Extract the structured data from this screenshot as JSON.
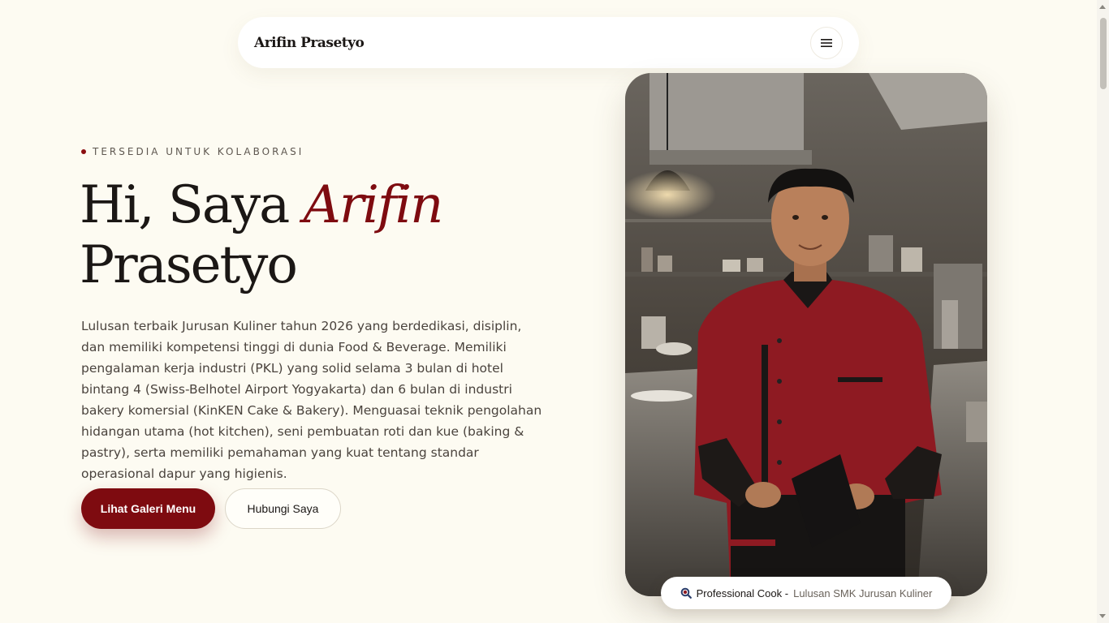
{
  "navbar": {
    "brand": "Arifin Prasetyo",
    "menu_icon": "hamburger-menu-icon"
  },
  "hero": {
    "eyebrow": "TERSEDIA UNTUK KOLABORASI",
    "headline_prefix": "Hi, Saya",
    "headline_accent": "Arifin",
    "headline_last": "Prasetyo",
    "description": "Lulusan terbaik Jurusan Kuliner tahun 2026 yang berdedikasi, disiplin, dan memiliki kompetensi tinggi di dunia Food & Beverage. Memiliki pengalaman kerja industri (PKL) yang solid selama 3 bulan di hotel bintang 4 (Swiss-Belhotel Airport Yogyakarta) dan 6 bulan di industri bakery komersial (KinKEN Cake & Bakery). Menguasai teknik pengolahan hidangan utama (hot kitchen), seni pembuatan roti dan kue (baking & pastry), serta memiliki pemahaman yang kuat tentang standar operasional dapur yang higienis.",
    "primary_button": "Lihat Galeri Menu",
    "secondary_button": "Hubungi Saya"
  },
  "photo": {
    "badge_title": "Professional Cook -",
    "badge_subtitle": "Lulusan SMK Jurusan Kuliner",
    "badge_icon": "search-icon"
  },
  "colors": {
    "background": "#fdfbf2",
    "accent": "#7e0b10",
    "text": "#1b1715"
  }
}
